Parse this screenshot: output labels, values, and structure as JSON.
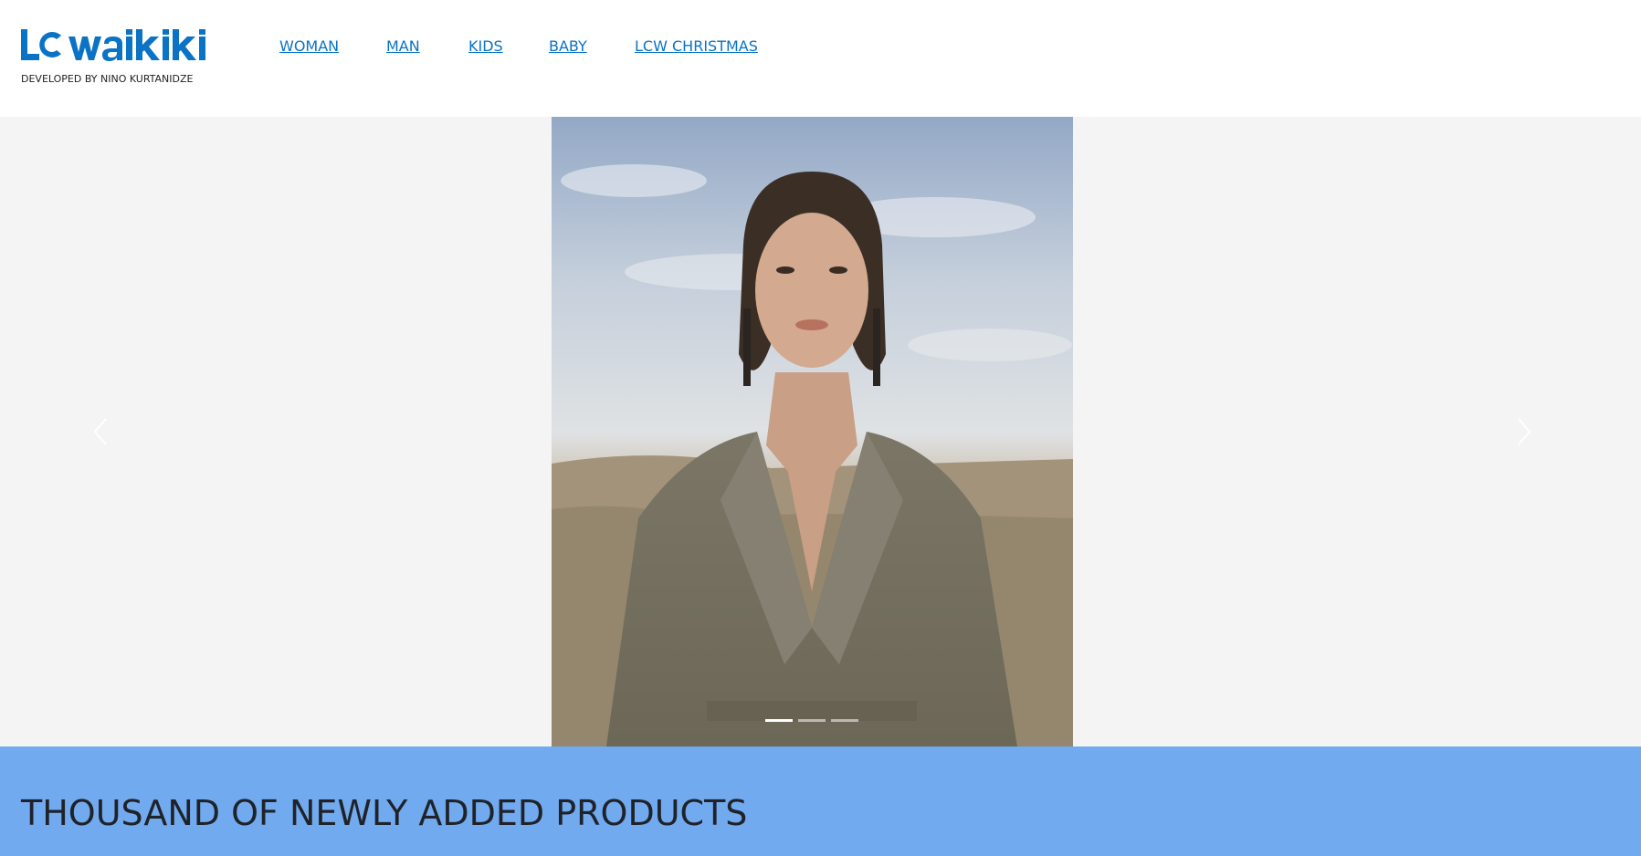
{
  "header": {
    "logo_text": "LC Waikiki",
    "tagline": "DEVELOPED BY NINO KURTANIDZE",
    "nav": [
      {
        "label": "WOMAN"
      },
      {
        "label": "MAN"
      },
      {
        "label": "KIDS"
      },
      {
        "label": "BABY"
      },
      {
        "label": "LCW CHRISTMAS"
      }
    ]
  },
  "hero": {
    "slide_count": 3,
    "active_slide": 1,
    "prev_icon": "chevron-left-icon",
    "next_icon": "chevron-right-icon"
  },
  "banner": {
    "title": "THOUSAND OF NEWLY ADDED PRODUCTS"
  },
  "colors": {
    "brand": "#0a73c5",
    "banner_bg": "#72aaef",
    "hero_bg": "#f4f4f4"
  }
}
